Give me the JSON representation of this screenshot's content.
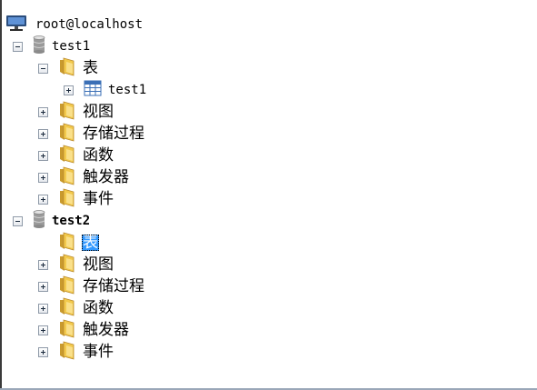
{
  "tree": {
    "root": {
      "label": "root@localhost",
      "icon": "computer-icon"
    },
    "databases": [
      {
        "label": "test1",
        "icon": "database-icon",
        "expanded": true,
        "bold": false,
        "children": [
          {
            "label": "表",
            "icon": "folder-icon",
            "expander": "minus",
            "selected": false
          },
          {
            "label": "test1",
            "icon": "table-icon",
            "expander": "plus"
          },
          {
            "label": "视图",
            "icon": "folder-icon",
            "expander": "plus"
          },
          {
            "label": "存储过程",
            "icon": "folder-icon",
            "expander": "plus"
          },
          {
            "label": "函数",
            "icon": "folder-icon",
            "expander": "plus"
          },
          {
            "label": "触发器",
            "icon": "folder-icon",
            "expander": "plus"
          },
          {
            "label": "事件",
            "icon": "folder-icon",
            "expander": "plus"
          }
        ]
      },
      {
        "label": "test2",
        "icon": "database-icon",
        "expanded": true,
        "bold": true,
        "children": [
          {
            "label": "表",
            "icon": "folder-icon",
            "expander": "none",
            "selected": true
          },
          {
            "label": "视图",
            "icon": "folder-icon",
            "expander": "plus"
          },
          {
            "label": "存储过程",
            "icon": "folder-icon",
            "expander": "plus"
          },
          {
            "label": "函数",
            "icon": "folder-icon",
            "expander": "plus"
          },
          {
            "label": "触发器",
            "icon": "folder-icon",
            "expander": "plus"
          },
          {
            "label": "事件",
            "icon": "folder-icon",
            "expander": "plus"
          }
        ]
      }
    ]
  },
  "colors": {
    "selection": "#3399ff",
    "folder": "#f2c94c",
    "table_grid": "#3b6fb6"
  }
}
